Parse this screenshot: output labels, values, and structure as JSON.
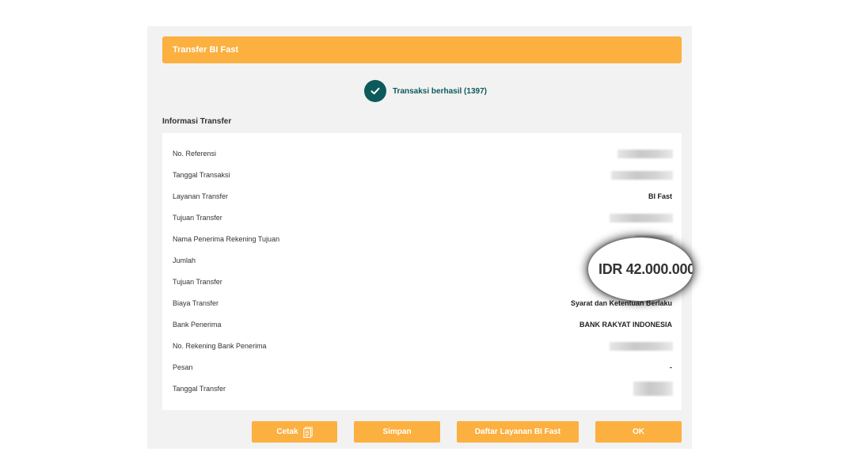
{
  "header": {
    "title": "Transfer BI Fast"
  },
  "status": {
    "text": "Transaksi berhasil (1397)",
    "icon": "check-icon"
  },
  "section": {
    "title": "Informasi Transfer"
  },
  "rows": [
    {
      "label": "No. Referensi",
      "value": ""
    },
    {
      "label": "Tanggal Transaksi",
      "value": ""
    },
    {
      "label": "Layanan Transfer",
      "value": "BI Fast"
    },
    {
      "label": "Tujuan Transfer",
      "value": ""
    },
    {
      "label": "Nama Penerima Rekening Tujuan",
      "value": ""
    },
    {
      "label": "Jumlah",
      "value": ""
    },
    {
      "label": "Tujuan Transfer",
      "value": ""
    },
    {
      "label": "Biaya Transfer",
      "value": "Syarat dan Ketentuan Berlaku"
    },
    {
      "label": "Bank Penerima",
      "value": "BANK RAKYAT INDONESIA"
    },
    {
      "label": "No. Rekening Bank Penerima",
      "value": ""
    },
    {
      "label": "Pesan",
      "value": "-"
    },
    {
      "label": "Tanggal Transfer",
      "value": ""
    }
  ],
  "amount_callout": {
    "text": "IDR 42.000.000"
  },
  "buttons": {
    "print": "Cetak",
    "save": "Simpan",
    "list": "Daftar Layanan BI Fast",
    "ok": "OK"
  },
  "colors": {
    "accent": "#fbb040",
    "status": "#0d5a5b"
  }
}
